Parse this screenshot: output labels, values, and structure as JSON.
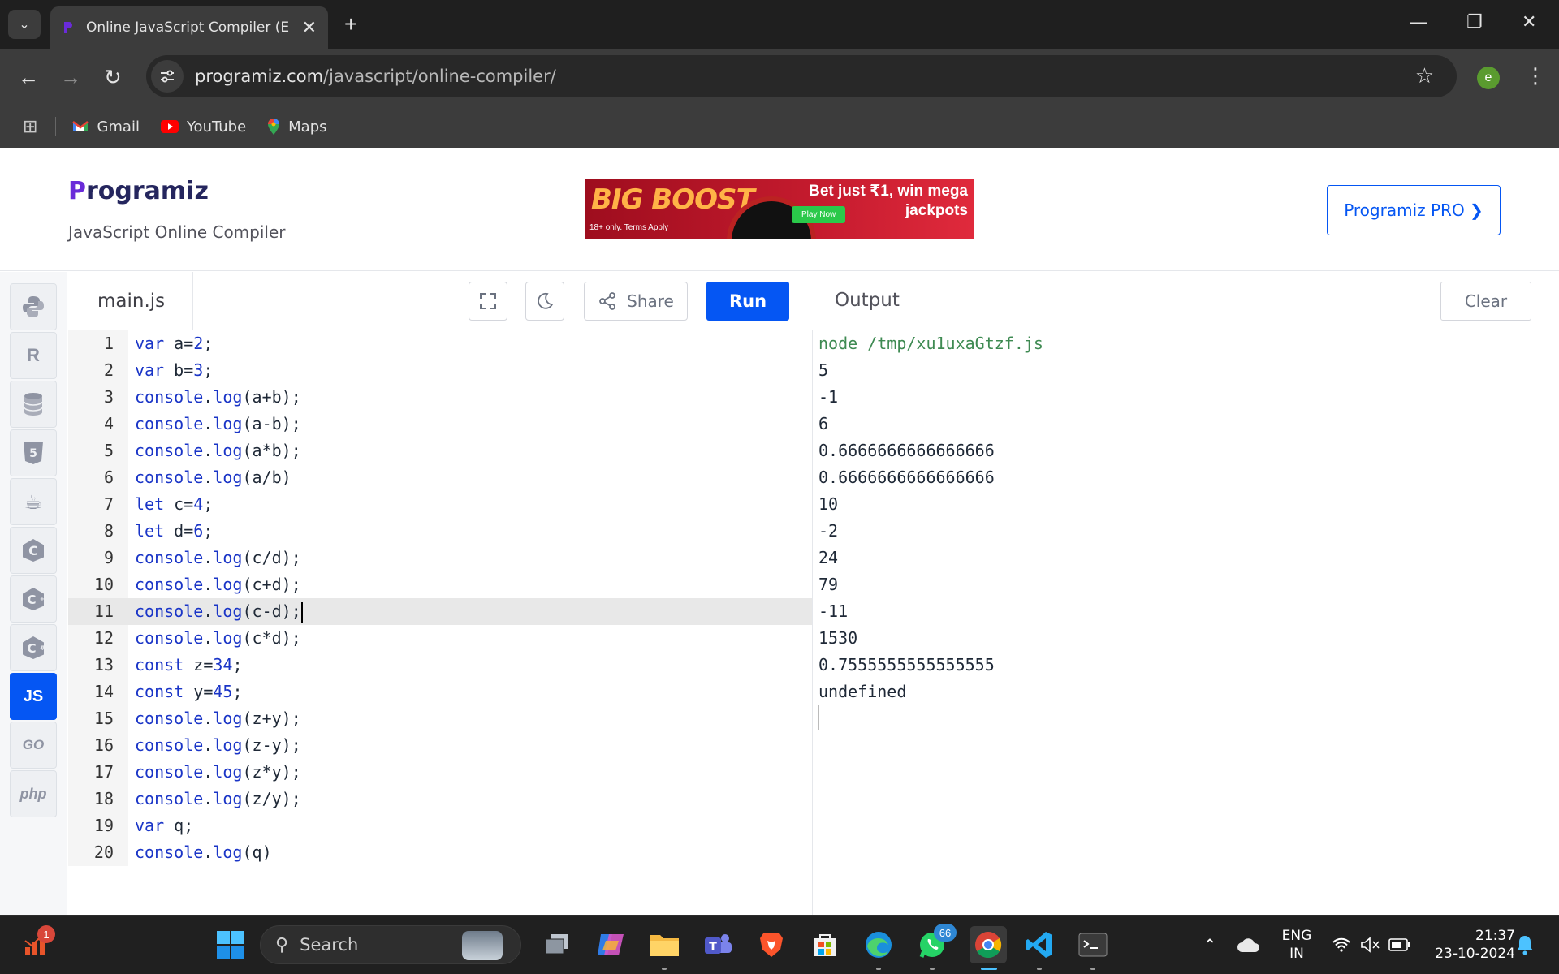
{
  "browser": {
    "tab_title": "Online JavaScript Compiler (Edi",
    "url_host": "programiz.com",
    "url_path": "/javascript/online-compiler/",
    "profile_initial": "e",
    "bookmarks": [
      {
        "label": "Gmail",
        "icon": "gmail-icon"
      },
      {
        "label": "YouTube",
        "icon": "youtube-icon"
      },
      {
        "label": "Maps",
        "icon": "maps-icon"
      }
    ]
  },
  "header": {
    "logo_first": "P",
    "logo_rest": "rogramiz",
    "subtitle": "JavaScript Online Compiler",
    "ad_brand": "BIG BOOST",
    "ad_headline_1": "Bet just ₹1, win mega",
    "ad_headline_2": "jackpots",
    "ad_cta": "Play Now",
    "ad_disclaimer": "18+ only. Terms Apply",
    "pro_button": "Programiz PRO ❯"
  },
  "languages": [
    {
      "name": "python-icon",
      "label": ""
    },
    {
      "name": "r-icon",
      "label": "R"
    },
    {
      "name": "sql-icon",
      "label": ""
    },
    {
      "name": "html5-icon",
      "label": "5"
    },
    {
      "name": "java-icon",
      "label": ""
    },
    {
      "name": "c-icon",
      "label": "C"
    },
    {
      "name": "cpp-icon",
      "label": "C"
    },
    {
      "name": "csharp-icon",
      "label": "C"
    },
    {
      "name": "js-icon",
      "label": "JS"
    },
    {
      "name": "go-icon",
      "label": "GO"
    },
    {
      "name": "php-icon",
      "label": "php"
    }
  ],
  "editor": {
    "filename": "main.js",
    "share_label": "Share",
    "run_label": "Run",
    "active_line": 11,
    "lines": [
      "var a=2;",
      "var b=3;",
      "console.log(a+b);",
      "console.log(a-b);",
      "console.log(a*b);",
      "console.log(a/b)",
      "let c=4;",
      "let d=6;",
      "console.log(c/d);",
      "console.log(c+d);",
      "console.log(c-d);",
      "console.log(c*d);",
      "const z=34;",
      "const y=45;",
      "console.log(z+y);",
      "console.log(z-y);",
      "console.log(z*y);",
      "console.log(z/y);",
      "var q;",
      "console.log(q)"
    ]
  },
  "output": {
    "title": "Output",
    "clear_label": "Clear",
    "command": "node /tmp/xu1uxaGtzf.js",
    "lines": [
      "5",
      "-1",
      "6",
      "0.6666666666666666",
      "0.6666666666666666",
      "10",
      "-2",
      "24",
      "79",
      "-11",
      "1530",
      "0.7555555555555555",
      "undefined"
    ]
  },
  "taskbar": {
    "search_placeholder": "Search",
    "notification_badge": "1",
    "whatsapp_badge": "66",
    "language_line1": "ENG",
    "language_line2": "IN",
    "time": "21:37",
    "date": "23-10-2024"
  }
}
